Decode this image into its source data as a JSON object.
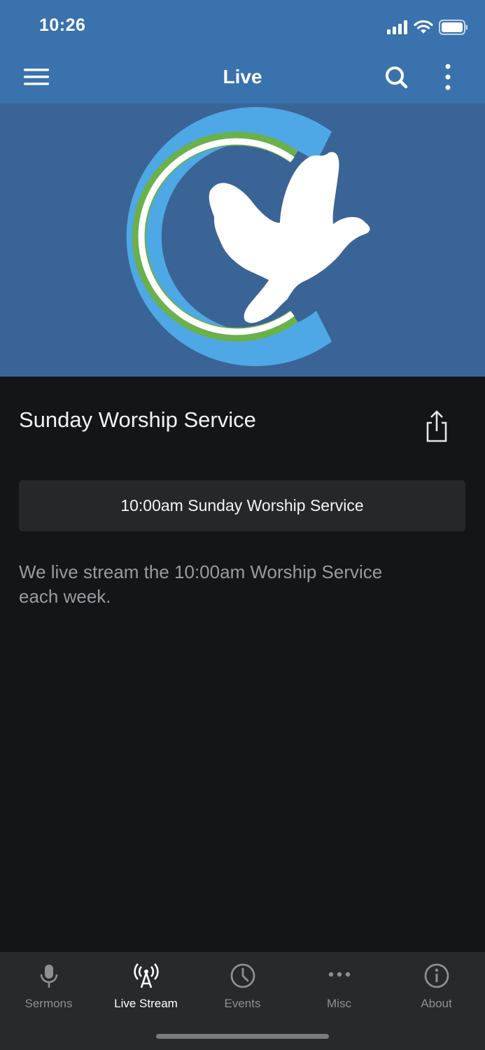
{
  "status_bar": {
    "time": "10:26"
  },
  "app_bar": {
    "title": "Live"
  },
  "content": {
    "title": "Sunday Worship Service",
    "service_button": "10:00am Sunday Worship Service",
    "description": "We live stream the 10:00am Worship Service each week."
  },
  "tabs": [
    {
      "label": "Sermons",
      "icon": "microphone-icon",
      "active": false
    },
    {
      "label": "Live Stream",
      "icon": "broadcast-icon",
      "active": true
    },
    {
      "label": "Events",
      "icon": "clock-icon",
      "active": false
    },
    {
      "label": "Misc",
      "icon": "more-horizontal-icon",
      "active": false
    },
    {
      "label": "About",
      "icon": "info-icon",
      "active": false
    }
  ],
  "colors": {
    "header": "#3a72ad",
    "hero_background": "#3b6496",
    "logo_blue": "#4ea8e6",
    "logo_green": "#6ab04c",
    "background": "#141517",
    "tabbar": "#28292b"
  }
}
